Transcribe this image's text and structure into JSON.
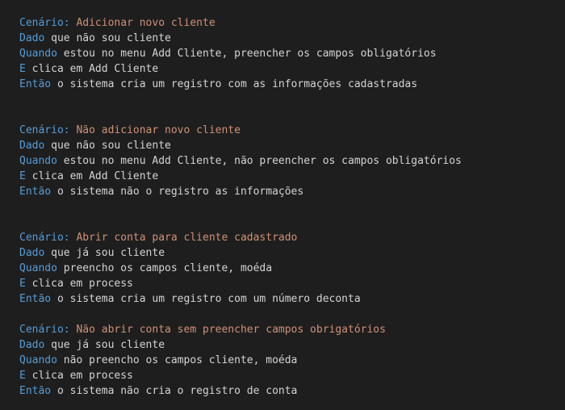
{
  "colors": {
    "background": "#1e1e1e",
    "keyword": "#569cd6",
    "scenario_title": "#ce9178",
    "text": "#d4d4d4"
  },
  "scenarios": [
    {
      "scenario_kw": "Cenário:",
      "title": "Adicionar novo cliente",
      "steps": [
        {
          "kw": "Dado",
          "text": "que não sou cliente"
        },
        {
          "kw": "Quando",
          "text": "estou no menu Add Cliente, preencher os campos obligatórios"
        },
        {
          "kw": "E",
          "text": "clica em Add Cliente"
        },
        {
          "kw": "Então",
          "text": "o sistema cria um registro com as informações cadastradas"
        }
      ]
    },
    {
      "scenario_kw": "Cenário:",
      "title": "Não adicionar novo cliente",
      "steps": [
        {
          "kw": "Dado",
          "text": "que não sou cliente"
        },
        {
          "kw": "Quando",
          "text": "estou no menu Add Cliente, não preencher os campos obligatórios"
        },
        {
          "kw": "E",
          "text": "clica em Add Cliente"
        },
        {
          "kw": "Então",
          "text": "o sistema não o registro as informações"
        }
      ]
    },
    {
      "scenario_kw": "Cenário:",
      "title": "Abrir conta para cliente cadastrado",
      "steps": [
        {
          "kw": "Dado",
          "text": "que já sou cliente"
        },
        {
          "kw": "Quando",
          "text": "preencho os campos cliente, moéda"
        },
        {
          "kw": "E",
          "text": "clica em process"
        },
        {
          "kw": "Então",
          "text": "o sistema cria um registro com um número deconta"
        }
      ]
    },
    {
      "scenario_kw": "Cenário:",
      "title": "Não abrir conta sem preencher campos obrigatórios",
      "steps": [
        {
          "kw": "Dado",
          "text": "que já sou cliente"
        },
        {
          "kw": "Quando",
          "text": "não preencho os campos cliente, moéda"
        },
        {
          "kw": "E",
          "text": "clica em process"
        },
        {
          "kw": "Então",
          "text": "o sistema não cria o registro de conta"
        }
      ]
    }
  ]
}
